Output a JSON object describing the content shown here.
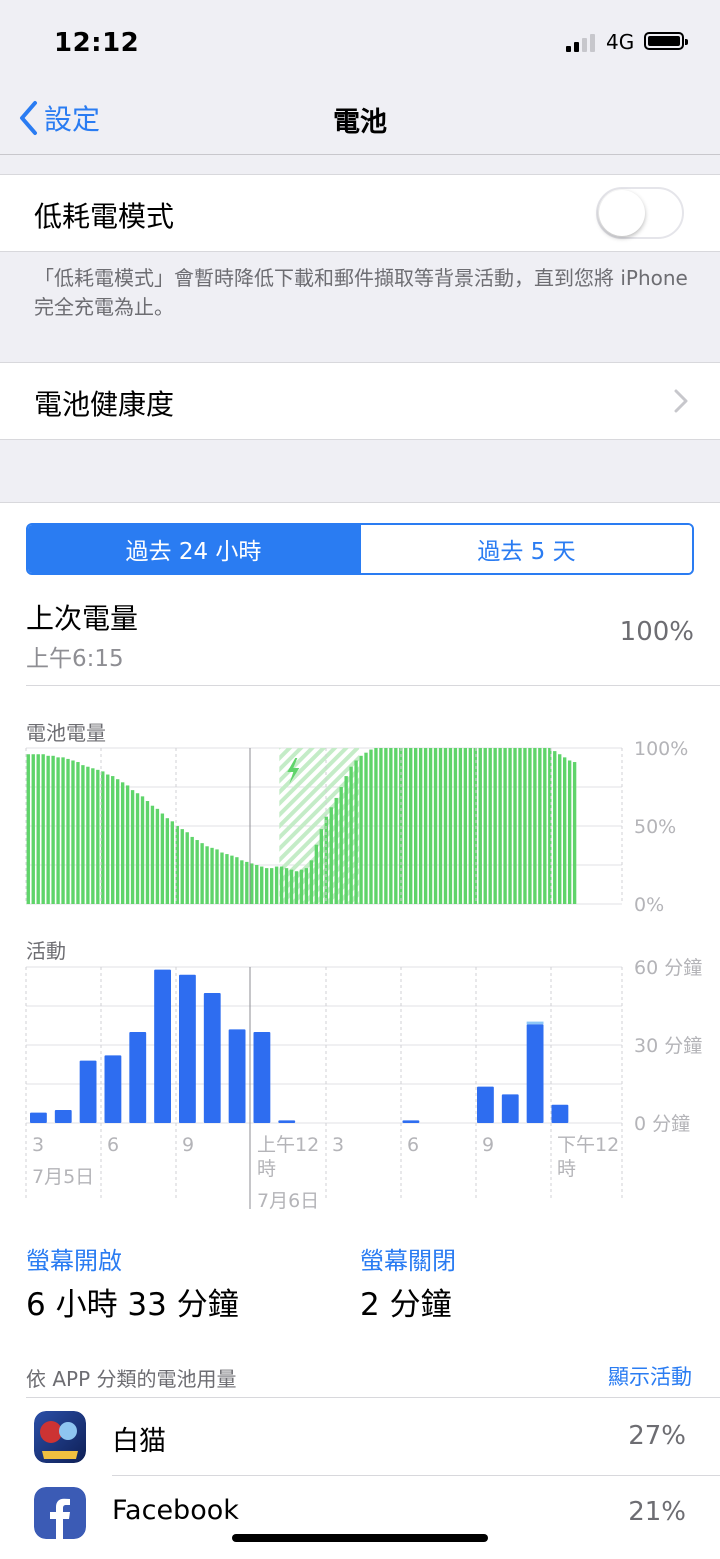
{
  "status_bar": {
    "time": "12:12",
    "network": "4G"
  },
  "nav": {
    "back_label": "設定",
    "title": "電池"
  },
  "low_power": {
    "label": "低耗電模式",
    "enabled": false,
    "footnote": "「低耗電模式」會暫時降低下載和郵件擷取等背景活動，直到您將 iPhone 完全充電為止。"
  },
  "health": {
    "label": "電池健康度"
  },
  "segments": {
    "options": [
      "過去 24 小時",
      "過去 5 天"
    ],
    "selected": "過去 24 小時"
  },
  "last_charge": {
    "title": "上次電量",
    "time": "上午6:15",
    "percent": "100%"
  },
  "chart_data": [
    {
      "type": "bar",
      "title": "電池電量",
      "y_ticks": [
        "100%",
        "50%",
        "0%"
      ],
      "ylim": [
        0,
        100
      ],
      "charging_start_index": 51,
      "charging_end_index": 57,
      "values": [
        96,
        96,
        96,
        96,
        95,
        95,
        94,
        94,
        93,
        92,
        91,
        89,
        88,
        87,
        86,
        85,
        83,
        82,
        80,
        78,
        76,
        73,
        71,
        69,
        66,
        63,
        61,
        58,
        55,
        53,
        50,
        48,
        46,
        43,
        41,
        39,
        37,
        36,
        35,
        33,
        32,
        31,
        30,
        28,
        27,
        26,
        25,
        24,
        23,
        23,
        24,
        24,
        23,
        22,
        21,
        22,
        23,
        28,
        38,
        48,
        56,
        62,
        68,
        75,
        82,
        88,
        92,
        95,
        97,
        99,
        100,
        100,
        100,
        100,
        100,
        100,
        100,
        100,
        100,
        100,
        100,
        100,
        100,
        100,
        100,
        100,
        100,
        100,
        100,
        100,
        100,
        100,
        100,
        100,
        100,
        100,
        100,
        100,
        100,
        100,
        100,
        100,
        100,
        100,
        100,
        100,
        98,
        96,
        94,
        92,
        91
      ]
    },
    {
      "type": "bar",
      "title": "活動",
      "y_ticks": [
        "60 分鐘",
        "30 分鐘",
        "0 分鐘"
      ],
      "ylim": [
        0,
        60
      ],
      "x_tick_labels": [
        "3",
        "6",
        "9",
        "上午12時",
        "3",
        "6",
        "9",
        "下午12時"
      ],
      "date_labels": [
        "7月5日",
        "7月6日"
      ],
      "values": [
        4,
        5,
        24,
        26,
        35,
        59,
        57,
        50,
        36,
        35,
        1,
        0,
        0,
        0,
        0,
        1,
        0,
        0,
        14,
        11,
        38,
        7
      ],
      "light_values": [
        0,
        0,
        0,
        0,
        0,
        0,
        0,
        0,
        0,
        0,
        0,
        0,
        0,
        0,
        0,
        0,
        0,
        0,
        0,
        0,
        1,
        0
      ]
    }
  ],
  "screen": {
    "on_label": "螢幕開啟",
    "on_value": "6 小時 33 分鐘",
    "off_label": "螢幕關閉",
    "off_value": "2 分鐘"
  },
  "usage": {
    "header": "依 APP 分類的電池用量",
    "action": "顯示活動",
    "apps": [
      {
        "name": "白猫",
        "percent": "27%"
      },
      {
        "name": "Facebook",
        "percent": "21%"
      }
    ]
  },
  "colors": {
    "accent": "#2a7cf2",
    "battery_green": "#5fd46a",
    "activity_blue": "#2e6df0"
  }
}
